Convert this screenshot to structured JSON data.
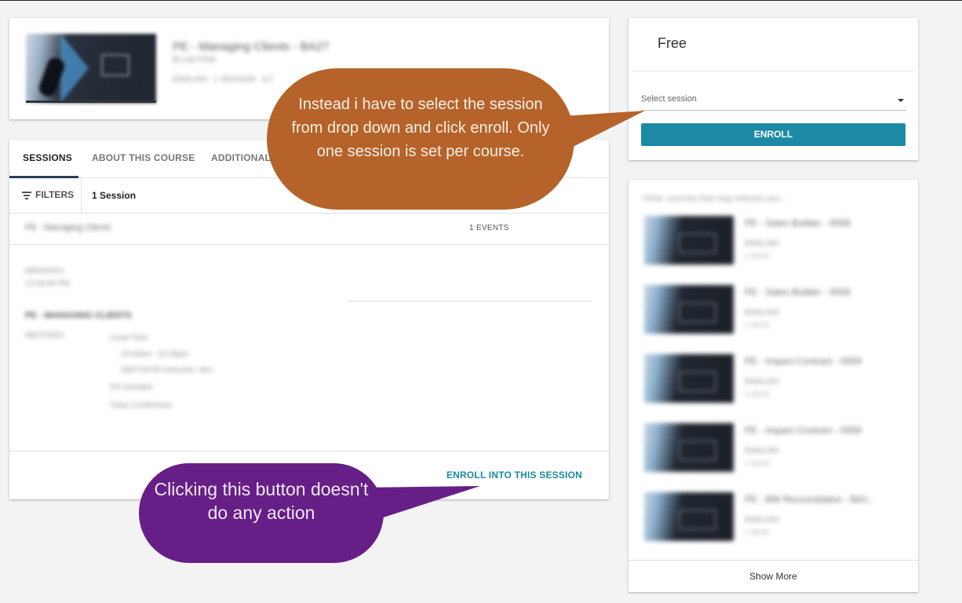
{
  "course": {
    "title": "PE - Managing Clients - BA27",
    "subtitle": "BI LMI PGM",
    "meta": "ENGLISH  ·  1 SESSION  ·  ILT"
  },
  "tabs": [
    {
      "label": "SESSIONS"
    },
    {
      "label": "ABOUT THIS COURSE"
    },
    {
      "label": "ADDITIONAL"
    }
  ],
  "filters": {
    "label": "FILTERS",
    "session_count": "1 Session"
  },
  "session": {
    "name": "PE - Managing Clients",
    "events_label": "1 EVENTS",
    "date_lines": [
      "08/02/2021",
      "12:00:00 PM"
    ],
    "event_title": "PE - MANAGING CLIENTS",
    "event_date": "08/27/2021",
    "event_details": [
      "Local Time",
      "10:00am - 01:00pm",
      "GMT-04:00 Instructor: Ann",
      "5% Includes",
      "Class Conference"
    ],
    "enroll_label": "ENROLL INTO THIS SESSION"
  },
  "pricing": {
    "price": "Free",
    "select_placeholder": "Select session",
    "enroll_label": "ENROLL"
  },
  "other_courses": {
    "heading": "Other courses that may interest you...",
    "items": [
      {
        "title": "PE - Sales Builder - 0058",
        "tag": "ENGLISH",
        "sub": "1 SESS"
      },
      {
        "title": "PE - Sales Builder - 0059",
        "tag": "ENGLISH",
        "sub": "1 SESS"
      },
      {
        "title": "PE - Impact Contract - 0059",
        "tag": "ENGLISH",
        "sub": "1 SESS"
      },
      {
        "title": "PE - Impact Contract - 0059",
        "tag": "ENGLISH",
        "sub": "1 SESS"
      },
      {
        "title": "PE - BW Reconciliation - BA1..",
        "tag": "ENGLISH",
        "sub": "1 SESS"
      }
    ],
    "show_more": "Show More"
  },
  "annotations": {
    "orange": "Instead i have to select the session from drop down and click enroll. Only one session is set per course.",
    "purple": "Clicking this button doesn't do any action"
  },
  "colors": {
    "accent": "#1c8aa5",
    "orange_callout": "#b5632a",
    "purple_callout": "#661f86"
  }
}
